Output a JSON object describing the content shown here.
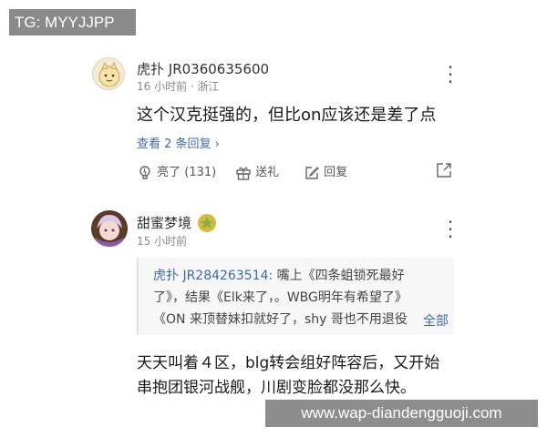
{
  "watermarks": {
    "top_left": "TG: MYYJJPP",
    "bottom_right": "www.wap-diandengguoji.com"
  },
  "comments": [
    {
      "username": "虎扑 JR0360635600",
      "meta": "16 小时前 · 浙江",
      "body": "这个汉克挺强的，但比on应该还是差了点",
      "replies_link": "查看 2 条回复 ›",
      "actions": {
        "like": "亮了 (131)",
        "gift": "送礼",
        "reply": "回复"
      }
    },
    {
      "username": "甜蜜梦境",
      "meta": "15 小时前",
      "quote": {
        "author": "虎扑 JR284263514:",
        "line1": " 嘴上《四条蛆锁死最好",
        "line2": "了》，结果《Elk来了，。WBG明年有希望了》",
        "line3": "《ON 来顶替妹扣就好了，shy 哥也不用退役",
        "more": "全部"
      },
      "body_line1": "天天叫着４区，blg转会组好阵容后，又开始",
      "body_line2": "串抱团银河战舰，川剧变脸都没那么快。"
    }
  ]
}
